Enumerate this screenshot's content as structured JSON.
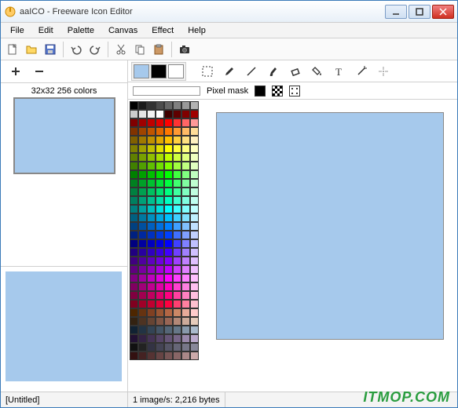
{
  "title": "aaICO - Freeware Icon Editor",
  "menu": [
    "File",
    "Edit",
    "Palette",
    "Canvas",
    "Effect",
    "Help"
  ],
  "iconlist": {
    "label": "32x32 256 colors"
  },
  "mask_label": "Pixel mask",
  "status": {
    "file": "[Untitled]",
    "info": "1 image/s: 2,216 bytes"
  },
  "colors": {
    "fg": "#a6c9ec",
    "mid": "#000000",
    "bg": "#ffffff"
  },
  "watermark": "ITMOP.COM",
  "palette": [
    "#000000",
    "#1a1a1a",
    "#333333",
    "#4d4d4d",
    "#666666",
    "#808080",
    "#999999",
    "#b3b3b3",
    "#cccccc",
    "#e6e6e6",
    "#f2f2f2",
    "#ffffff",
    "#400000",
    "#600000",
    "#800000",
    "#a00000",
    "#800000",
    "#a00000",
    "#c00000",
    "#e00000",
    "#ff0000",
    "#ff3333",
    "#ff6666",
    "#ff9999",
    "#803300",
    "#a04400",
    "#c05500",
    "#e06600",
    "#ff7700",
    "#ff9933",
    "#ffbb66",
    "#ffdd99",
    "#806000",
    "#a07800",
    "#c09000",
    "#e0a800",
    "#ffc000",
    "#ffd040",
    "#ffe080",
    "#fff0c0",
    "#808000",
    "#a0a000",
    "#c0c000",
    "#e0e000",
    "#ffff00",
    "#ffff40",
    "#ffff80",
    "#ffffc0",
    "#608000",
    "#78a000",
    "#90c000",
    "#a8e000",
    "#c0ff00",
    "#d0ff40",
    "#e0ff80",
    "#f0ffc0",
    "#408000",
    "#50a000",
    "#60c000",
    "#70e000",
    "#80ff00",
    "#a0ff40",
    "#c0ff80",
    "#e0ffc0",
    "#008000",
    "#00a000",
    "#00c000",
    "#00e000",
    "#00ff00",
    "#40ff40",
    "#80ff80",
    "#c0ffc0",
    "#008020",
    "#00a028",
    "#00c030",
    "#00e038",
    "#00ff40",
    "#40ff70",
    "#80ffa0",
    "#c0ffd0",
    "#008040",
    "#00a050",
    "#00c060",
    "#00e070",
    "#00ff80",
    "#40ffa0",
    "#80ffc0",
    "#c0ffe0",
    "#008060",
    "#00a078",
    "#00c090",
    "#00e0a8",
    "#00ffc0",
    "#40ffd0",
    "#80ffe0",
    "#c0fff0",
    "#008080",
    "#00a0a0",
    "#00c0c0",
    "#00e0e0",
    "#00ffff",
    "#40ffff",
    "#80ffff",
    "#c0ffff",
    "#006080",
    "#0078a0",
    "#0090c0",
    "#00a8e0",
    "#00c0ff",
    "#40d0ff",
    "#80e0ff",
    "#c0f0ff",
    "#004080",
    "#0050a0",
    "#0060c0",
    "#0070e0",
    "#0080ff",
    "#40a0ff",
    "#80c0ff",
    "#c0e0ff",
    "#002080",
    "#0028a0",
    "#0030c0",
    "#0038e0",
    "#0040ff",
    "#4070ff",
    "#80a0ff",
    "#c0d0ff",
    "#000080",
    "#0000a0",
    "#0000c0",
    "#0000e0",
    "#0000ff",
    "#4040ff",
    "#8080ff",
    "#c0c0ff",
    "#200080",
    "#2800a0",
    "#3000c0",
    "#3800e0",
    "#4000ff",
    "#7040ff",
    "#a080ff",
    "#d0c0ff",
    "#400080",
    "#5000a0",
    "#6000c0",
    "#7000e0",
    "#8000ff",
    "#a040ff",
    "#c080ff",
    "#e0c0ff",
    "#600080",
    "#7800a0",
    "#9000c0",
    "#a800e0",
    "#c000ff",
    "#d040ff",
    "#e080ff",
    "#f0c0ff",
    "#800080",
    "#a000a0",
    "#c000c0",
    "#e000e0",
    "#ff00ff",
    "#ff40ff",
    "#ff80ff",
    "#ffc0ff",
    "#800060",
    "#a00078",
    "#c00090",
    "#e000a8",
    "#ff00c0",
    "#ff40d0",
    "#ff80e0",
    "#ffc0f0",
    "#800040",
    "#a00050",
    "#c00060",
    "#e00070",
    "#ff0080",
    "#ff40a0",
    "#ff80c0",
    "#ffc0e0",
    "#800020",
    "#a00028",
    "#c00030",
    "#e00038",
    "#ff0040",
    "#ff4070",
    "#ff80a0",
    "#ffc0d0",
    "#4d2600",
    "#663311",
    "#804022",
    "#995533",
    "#b36644",
    "#cc8866",
    "#e6aa99",
    "#ffcccc",
    "#332211",
    "#4d3322",
    "#664433",
    "#805544",
    "#996655",
    "#b38877",
    "#ccaa99",
    "#e6ccbb",
    "#112233",
    "#223344",
    "#334455",
    "#445566",
    "#556677",
    "#667788",
    "#8899aa",
    "#aabbcc",
    "#221133",
    "#332244",
    "#443355",
    "#554466",
    "#665577",
    "#776688",
    "#9988aa",
    "#bbaacc",
    "#111111",
    "#222222",
    "#333344",
    "#444455",
    "#555566",
    "#666677",
    "#777788",
    "#888899",
    "#331111",
    "#442222",
    "#553333",
    "#664444",
    "#775555",
    "#886666",
    "#aa8888",
    "#ccaaaa"
  ]
}
